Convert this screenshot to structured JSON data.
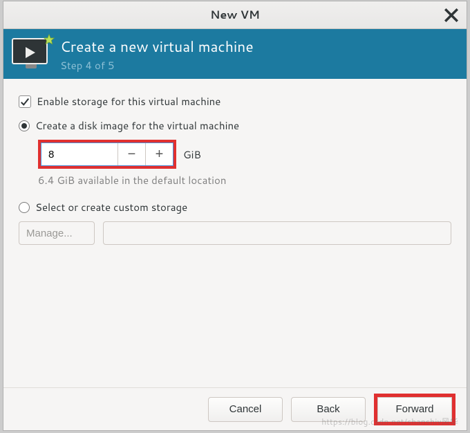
{
  "titlebar": {
    "title": "New VM"
  },
  "header": {
    "heading": "Create a new virtual machine",
    "step": "Step 4 of 5"
  },
  "content": {
    "enable_storage_label": "Enable storage for this virtual machine",
    "enable_storage_checked": true,
    "create_disk_label": "Create a disk image for the virtual machine",
    "disk_size_value": "8",
    "disk_size_unit": "GiB",
    "available_hint": "6.4 GiB available in the default location",
    "custom_storage_label": "Select or create custom storage",
    "manage_button": "Manage...",
    "custom_path": ""
  },
  "footer": {
    "cancel": "Cancel",
    "back": "Back",
    "forward": "Forward"
  },
  "watermark": "https://blog.csdn.net/shanshiv风华",
  "icons": {
    "close": "close-icon",
    "vm": "vm-monitor-icon",
    "new_star": "new-star-icon",
    "check": "checkmark-icon",
    "minus": "minus-icon",
    "plus": "plus-icon"
  }
}
